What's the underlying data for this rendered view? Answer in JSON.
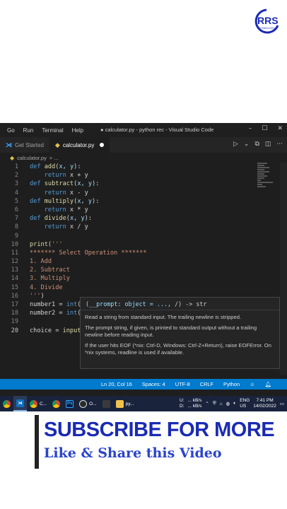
{
  "brand": {
    "logo_text": "RRS",
    "accent_color": "#1b2bb4"
  },
  "window": {
    "menu": [
      "Go",
      "Run",
      "Terminal",
      "Help"
    ],
    "title": "● calculator.py - python rec - Visual Studio Code",
    "controls": {
      "minimize": "–",
      "maximize": "☐",
      "close": "✕"
    }
  },
  "tabs": [
    {
      "label": "Get Started",
      "active": false
    },
    {
      "label": "calculator.py",
      "active": true,
      "modified": true
    }
  ],
  "breadcrumb": {
    "file": "calculator.py",
    "rest": "> ..."
  },
  "editor": {
    "lines": [
      {
        "n": "1",
        "text": "def add(x, y):"
      },
      {
        "n": "2",
        "text": "    return x + y"
      },
      {
        "n": "3",
        "text": "def subtract(x, y):"
      },
      {
        "n": "4",
        "text": "    return x - y"
      },
      {
        "n": "5",
        "text": "def multiply(x, y):"
      },
      {
        "n": "6",
        "text": "    return x * y"
      },
      {
        "n": "7",
        "text": "def divide(x, y):"
      },
      {
        "n": "8",
        "text": "    return x / y"
      },
      {
        "n": "9",
        "text": ""
      },
      {
        "n": "10",
        "text": "print('''"
      },
      {
        "n": "11",
        "text": "******* Select Operation *******"
      },
      {
        "n": "12",
        "text": "1. Add"
      },
      {
        "n": "13",
        "text": "2. Subtract"
      },
      {
        "n": "14",
        "text": "3. Multiply"
      },
      {
        "n": "15",
        "text": "4. Divide"
      },
      {
        "n": "16",
        "text": "''')"
      },
      {
        "n": "17",
        "text": "number1 = int(i"
      },
      {
        "n": "18",
        "text": "number2 = int(i"
      },
      {
        "n": "19",
        "text": ""
      },
      {
        "n": "20",
        "text": "choice = input()"
      }
    ],
    "current_line": "20"
  },
  "hover": {
    "signature_prefix": "(",
    "signature_param": "__prompt: object = ...",
    "signature_suffix": ", /) -> str",
    "p1": "Read a string from standard input. The trailing newline is stripped.",
    "p2": "The prompt string, if given, is printed to standard output without a trailing newline before reading input.",
    "p3": "If the user hits EOF (*nix: Ctrl-D, Windows: Ctrl-Z+Return), raise EOFError. On *nix systems, readline is used if available."
  },
  "status": {
    "position": "Ln 20, Col 16",
    "spaces": "Spaces: 4",
    "encoding": "UTF-8",
    "eol": "CRLF",
    "language": "Python"
  },
  "taskbar": {
    "items": [
      {
        "label": "",
        "icon": "chrome-icon"
      },
      {
        "label": "",
        "icon": "vscode-icon"
      },
      {
        "label": "C...",
        "icon": "chrome-icon"
      },
      {
        "label": "",
        "icon": "chrome-icon"
      },
      {
        "label": "Ps",
        "icon": "photoshop-icon"
      },
      {
        "label": "O...",
        "icon": "obs-icon"
      },
      {
        "label": "",
        "icon": "explorer-icon"
      },
      {
        "label": "py...",
        "icon": "folder-icon"
      }
    ],
    "net_u_label": "U:",
    "net_d_label": "D:",
    "net_u": "... kB/s",
    "net_d": "... kB/s",
    "lang_top": "ENG",
    "lang_bottom": "US",
    "time": "7:41 PM",
    "date": "14/02/2022"
  },
  "banner": {
    "title": "SUBSCRIBE FOR MORE",
    "subtitle": "Like & Share this Video"
  }
}
